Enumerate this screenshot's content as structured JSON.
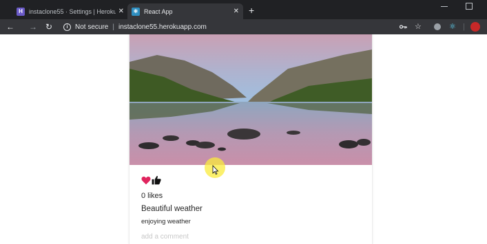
{
  "browser": {
    "tabs": [
      {
        "title": "instaclone55 · Settings | Heroku",
        "favicon": "heroku-icon",
        "active": false
      },
      {
        "title": "React App",
        "favicon": "react-icon",
        "active": true
      }
    ],
    "new_tab_label": "+",
    "security_label": "Not secure",
    "separator": "|",
    "url": "instaclone55.herokuapp.com"
  },
  "post": {
    "likes_text": "0 likes",
    "title": "Beautiful weather",
    "caption": "enjoying weather",
    "comment_placeholder": "add a comment"
  },
  "colors": {
    "like_heart": "#e0245e",
    "text": "#262626",
    "chrome_dark": "#202124",
    "chrome_toolbar": "#35363a"
  }
}
